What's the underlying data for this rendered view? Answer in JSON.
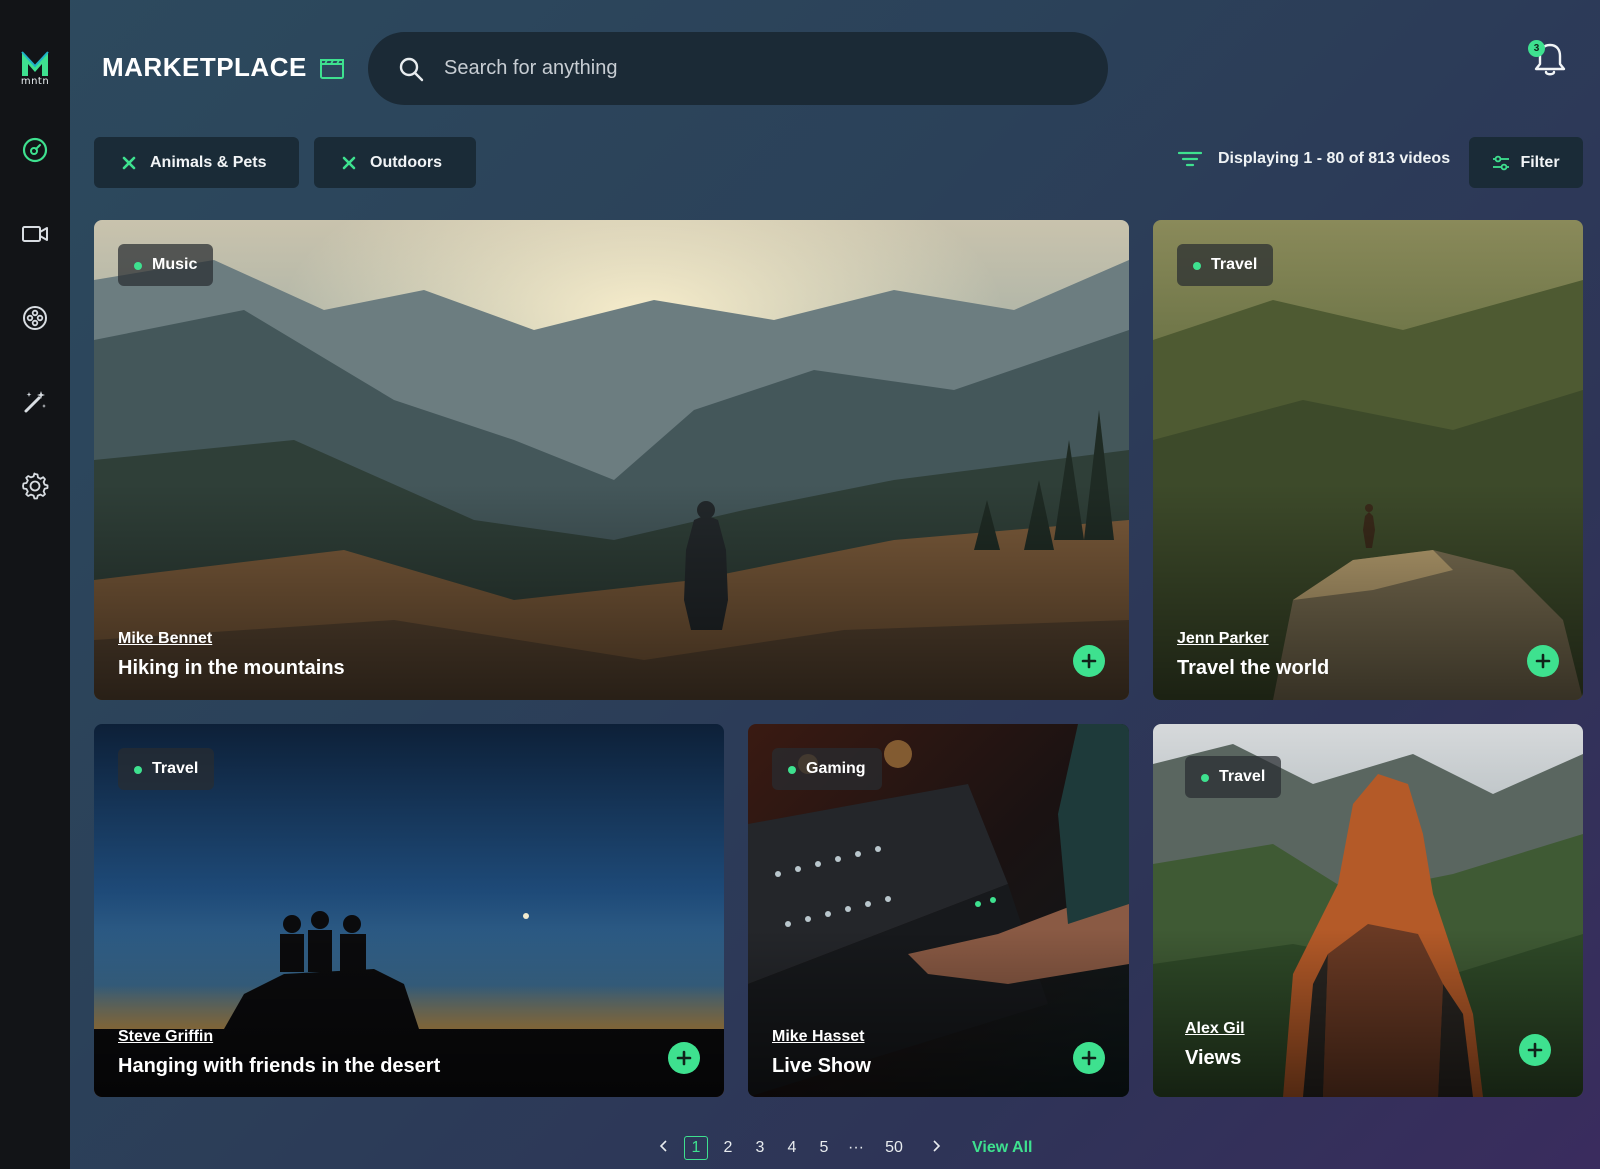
{
  "sidebar": {
    "logo_text": "mntn",
    "items": [
      {
        "icon": "gauge-icon"
      },
      {
        "icon": "video-camera-icon"
      },
      {
        "icon": "film-reel-icon"
      },
      {
        "icon": "magic-wand-icon"
      },
      {
        "icon": "gear-icon"
      }
    ]
  },
  "header": {
    "title": "MARKETPLACE",
    "search_placeholder": "Search for anything",
    "notification_count": "3"
  },
  "filters": {
    "chips": [
      "Animals & Pets",
      "Outdoors"
    ],
    "results_text": "Displaying 1 - 80 of 813 videos",
    "filter_label": "Filter"
  },
  "cards": [
    {
      "tag": "Music",
      "author": "Mike Bennet",
      "title": "Hiking in the mountains"
    },
    {
      "tag": "Travel",
      "author": "Jenn Parker",
      "title": "Travel the world"
    },
    {
      "tag": "Travel",
      "author": "Steve Griffin",
      "title": "Hanging with friends in the desert"
    },
    {
      "tag": "Gaming",
      "author": "Mike Hasset",
      "title": "Live Show"
    },
    {
      "tag": "Travel",
      "author": "Alex Gil",
      "title": "Views"
    }
  ],
  "pagination": {
    "pages": [
      "1",
      "2",
      "3",
      "4",
      "5",
      "···",
      "50"
    ],
    "current": "1",
    "view_all": "View All"
  },
  "colors": {
    "accent": "#3ee18f",
    "sidebar": "#121417",
    "panel": "#1a2b37"
  }
}
